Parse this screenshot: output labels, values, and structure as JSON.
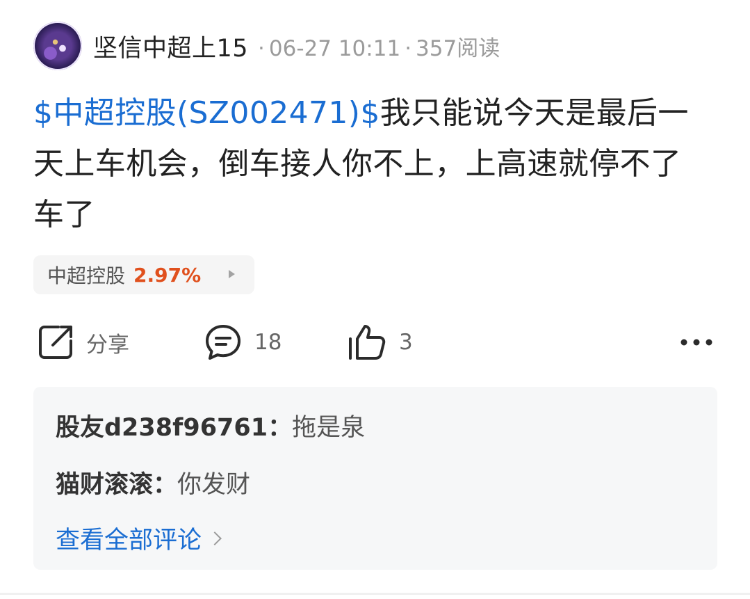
{
  "header": {
    "author": "坚信中超上15",
    "separator": "·",
    "date": "06-27 10:11",
    "reads": "357阅读"
  },
  "post": {
    "stock_link": "$中超控股(SZ002471)$",
    "text": "我只能说今天是最后一天上车机会，倒车接人你不上，上高速就停不了车了"
  },
  "stock_chip": {
    "name": "中超控股",
    "change": "2.97%",
    "change_color": "#e0501d",
    "icon": "caret-right-icon"
  },
  "actions": {
    "share": {
      "icon": "share-icon",
      "label": "分享"
    },
    "comment": {
      "icon": "comment-icon",
      "count": "18"
    },
    "like": {
      "icon": "thumbs-up-icon",
      "count": "3"
    },
    "more": {
      "icon": "more-dots-icon"
    }
  },
  "comments": {
    "items": [
      {
        "user": "股友d238f96761：",
        "text": "拖是泉"
      },
      {
        "user": "猫财滚滚：",
        "text": "你发财"
      }
    ],
    "view_all": "查看全部评论"
  },
  "colors": {
    "link": "#1a6dd2",
    "up": "#e0501d",
    "muted": "#9b9b9b"
  }
}
